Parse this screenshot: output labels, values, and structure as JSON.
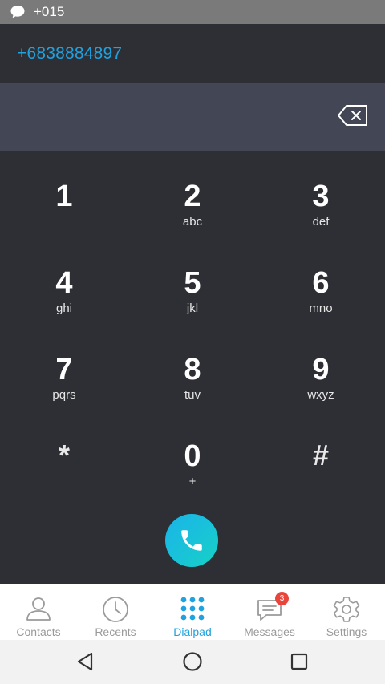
{
  "status_bar": {
    "text": "+015",
    "icon": "chat-bubble-icon"
  },
  "header": {
    "caller_id": "+6838884897"
  },
  "entry": {
    "value": ""
  },
  "dialpad": {
    "keys": [
      {
        "digit": "1",
        "letters": ""
      },
      {
        "digit": "2",
        "letters": "abc"
      },
      {
        "digit": "3",
        "letters": "def"
      },
      {
        "digit": "4",
        "letters": "ghi"
      },
      {
        "digit": "5",
        "letters": "jkl"
      },
      {
        "digit": "6",
        "letters": "mno"
      },
      {
        "digit": "7",
        "letters": "pqrs"
      },
      {
        "digit": "8",
        "letters": "tuv"
      },
      {
        "digit": "9",
        "letters": "wxyz"
      },
      {
        "digit": "*",
        "letters": ""
      },
      {
        "digit": "0",
        "letters": "+"
      },
      {
        "digit": "#",
        "letters": ""
      }
    ]
  },
  "tabs": [
    {
      "label": "Contacts",
      "icon": "person-icon",
      "active": false
    },
    {
      "label": "Recents",
      "icon": "clock-icon",
      "active": false
    },
    {
      "label": "Dialpad",
      "icon": "dialpad-grid-icon",
      "active": true
    },
    {
      "label": "Messages",
      "icon": "message-icon",
      "active": false,
      "badge": "3"
    },
    {
      "label": "Settings",
      "icon": "gear-icon",
      "active": false
    }
  ],
  "colors": {
    "accent": "#1ea2e0",
    "background": "#2e2f34",
    "entry_bar": "#434655",
    "badge": "#e8453c"
  }
}
